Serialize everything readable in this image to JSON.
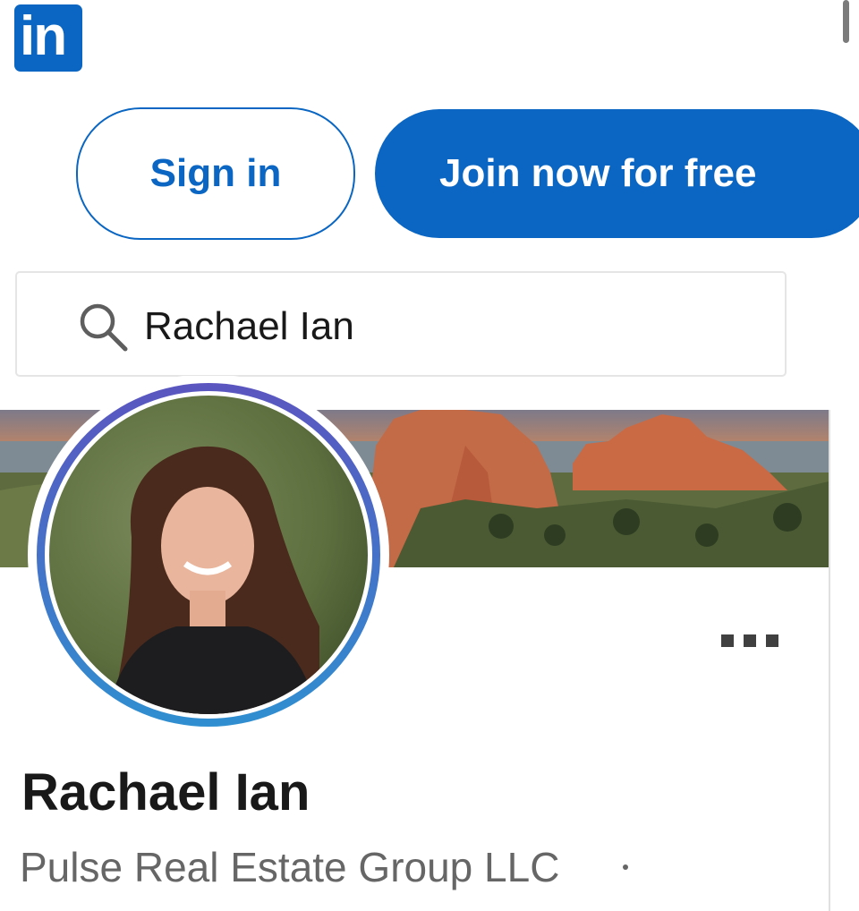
{
  "header": {
    "logo_text": "in",
    "logo_icon": "linkedin-logo",
    "brand_color": "#0a66c2"
  },
  "auth": {
    "sign_in_label": "Sign in",
    "join_label": "Join now for free"
  },
  "search": {
    "value": "Rachael Ian",
    "icon": "search-icon"
  },
  "profile": {
    "name": "Rachael Ian",
    "company": "Pulse Real Estate Group LLC",
    "more_icon": "more-options-icon"
  }
}
